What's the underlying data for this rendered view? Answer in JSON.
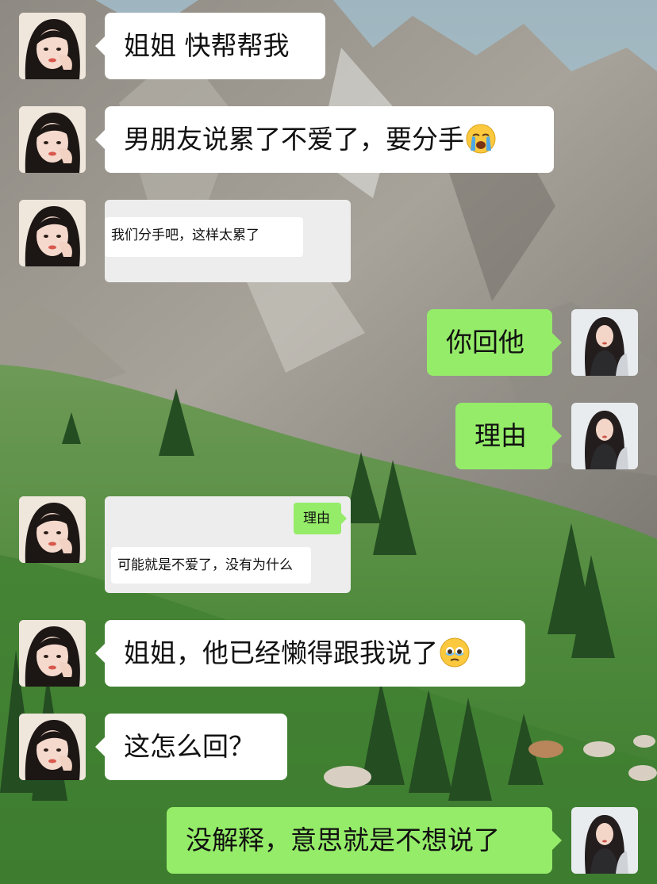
{
  "messages": [
    {
      "side": "left",
      "text": "姐姐 快帮帮我"
    },
    {
      "side": "left",
      "text": "男朋友说累了不爱了，要分手",
      "emoji": "loudly-crying-face-emoji"
    },
    {
      "side": "left",
      "type": "screenshot",
      "inner": [
        "我们分手吧，这样太累了"
      ]
    },
    {
      "side": "right",
      "text": "你回他"
    },
    {
      "side": "right",
      "text": "理由"
    },
    {
      "side": "left",
      "type": "screenshot",
      "inner_right": "理由",
      "inner_left": "可能就是不爱了，没有为什么"
    },
    {
      "side": "left",
      "text": "姐姐，他已经懒得跟我说了",
      "emoji": "holding-back-tears-emoji"
    },
    {
      "side": "left",
      "text": "这怎么回？"
    },
    {
      "side": "right",
      "text": "没解释，意思就是不想说了"
    }
  ],
  "colors": {
    "bubble_right": "#95ec69",
    "bubble_left": "#ffffff",
    "screenshot_bg": "#ededed",
    "text": "#111111"
  },
  "icons": {
    "left_avatar": "girl-avatar-icon",
    "right_avatar": "woman-avatar-icon",
    "background": "mountain-meadow-wallpaper"
  }
}
